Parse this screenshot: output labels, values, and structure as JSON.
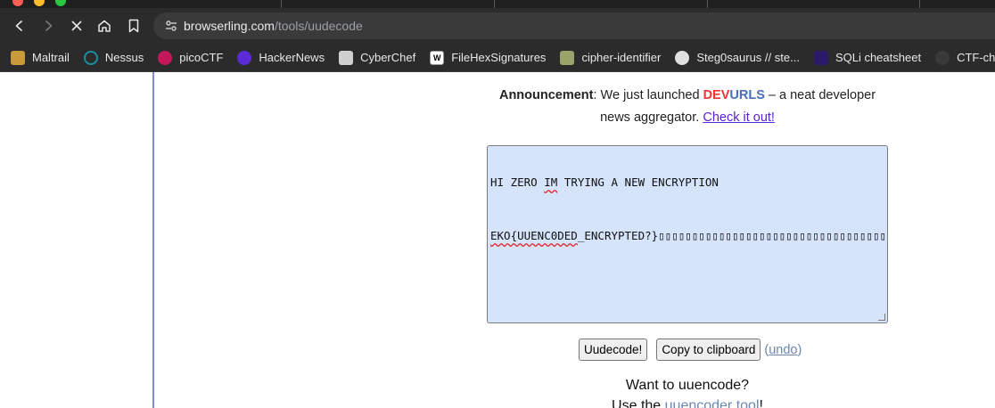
{
  "browser": {
    "url_host": "browserling.com",
    "url_path": "/tools/uudecode"
  },
  "bookmarks": [
    {
      "label": "Maltrail",
      "icon": "maltrail-icon",
      "color": "#c89a3a"
    },
    {
      "label": "Nessus",
      "icon": "nessus-icon",
      "color": "#1a8fa0"
    },
    {
      "label": "picoCTF",
      "icon": "picoctf-icon",
      "color": "#c2185b"
    },
    {
      "label": "HackerNews",
      "icon": "hackernews-icon",
      "color": "#5b2bd6"
    },
    {
      "label": "CyberChef",
      "icon": "cyberchef-icon",
      "color": "#cfcfcf"
    },
    {
      "label": "FileHexSignatures",
      "icon": "wikipedia-icon",
      "color": "#ffffff"
    },
    {
      "label": "cipher-identifier",
      "icon": "cipher-identifier-icon",
      "color": "#9aa36a"
    },
    {
      "label": "Steg0saurus // ste...",
      "icon": "steg0saurus-icon",
      "color": "#e0e0e0"
    },
    {
      "label": "SQLi cheatsheet",
      "icon": "sqli-icon",
      "color": "#2a1a6a"
    },
    {
      "label": "CTF-check",
      "icon": "github-icon",
      "color": "#3a3a3a"
    }
  ],
  "announcement": {
    "lead": "Announcement",
    "text1": ": We just launched ",
    "dev": "DEV",
    "urls": "URLS",
    "text2": " – a neat developer news aggregator. ",
    "link": "Check it out!"
  },
  "textarea": {
    "line1_a": "HI ZERO ",
    "line1_im": "IM",
    "line1_b": " TRYING A NEW ENCRYPTION",
    "line2_a": "EKO{UUENC0DED",
    "line2_b": "_ENCRYPTED?}",
    "line2_tail": "▯▯▯▯▯▯▯▯▯▯▯▯▯▯▯▯▯▯▯▯▯▯▯▯▯▯▯▯▯▯▯▯▯▯▯▯▯▯▯▯▯"
  },
  "buttons": {
    "uudecode": "Uudecode!",
    "copy": "Copy to clipboard",
    "undo_open": "(",
    "undo": "undo",
    "undo_close": ")"
  },
  "footer": {
    "want": "Want to uuencode?",
    "use_the": "Use the ",
    "tool_link": "uuencoder tool",
    "end": "!"
  }
}
